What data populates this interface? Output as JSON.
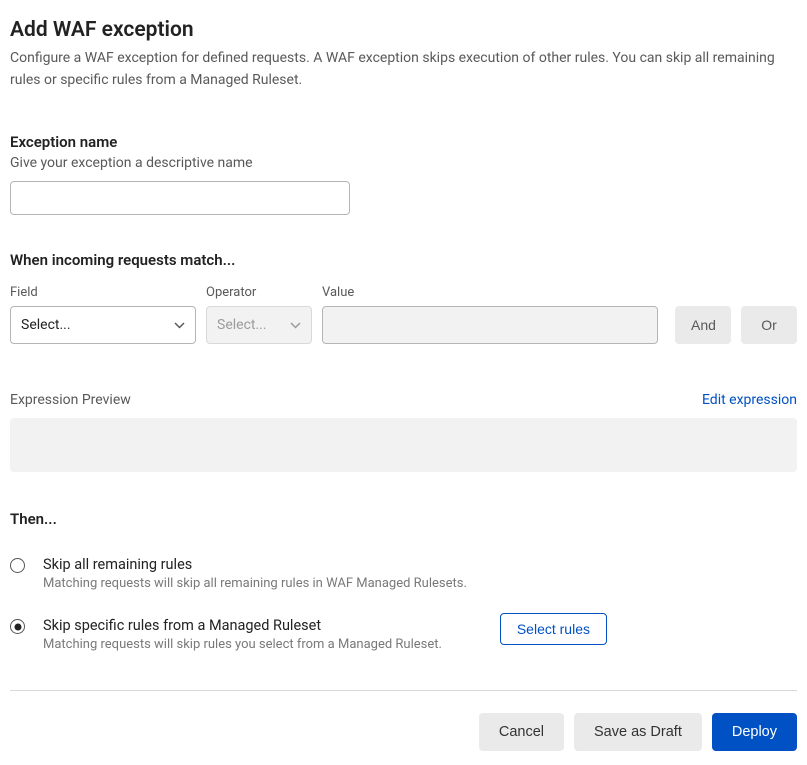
{
  "header": {
    "title": "Add WAF exception",
    "description": "Configure a WAF exception for defined requests. A WAF exception skips execution of other rules. You can skip all remaining rules or specific rules from a Managed Ruleset."
  },
  "exceptionName": {
    "label": "Exception name",
    "help": "Give your exception a descriptive name",
    "value": ""
  },
  "match": {
    "title": "When incoming requests match...",
    "fieldLabel": "Field",
    "operatorLabel": "Operator",
    "valueLabel": "Value",
    "fieldPlaceholder": "Select...",
    "operatorPlaceholder": "Select...",
    "valueInput": "",
    "andLabel": "And",
    "orLabel": "Or"
  },
  "expression": {
    "label": "Expression Preview",
    "editLink": "Edit expression",
    "preview": ""
  },
  "then": {
    "title": "Then...",
    "options": [
      {
        "label": "Skip all remaining rules",
        "help": "Matching requests will skip all remaining rules in WAF Managed Rulesets.",
        "selected": false
      },
      {
        "label": "Skip specific rules from a Managed Ruleset",
        "help": "Matching requests will skip rules you select from a Managed Ruleset.",
        "selected": true
      }
    ],
    "selectRulesButton": "Select rules"
  },
  "footer": {
    "cancel": "Cancel",
    "saveDraft": "Save as Draft",
    "deploy": "Deploy"
  }
}
